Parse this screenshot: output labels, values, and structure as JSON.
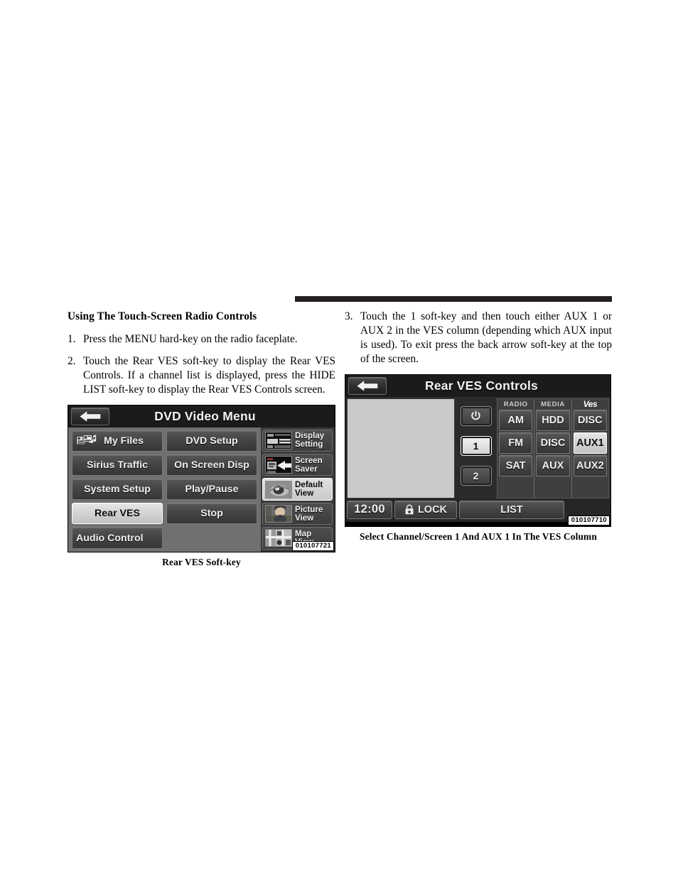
{
  "page": {
    "section_title": "Using The Touch-Screen Radio Controls"
  },
  "steps": [
    {
      "num": "1.",
      "text": "Press the MENU hard-key on the radio faceplate."
    },
    {
      "num": "2.",
      "text": "Touch the Rear VES soft-key to display the Rear VES Controls. If a channel list is displayed, press the HIDE LIST soft-key to display the Rear VES Controls screen."
    },
    {
      "num": "3.",
      "text": "Touch the 1 soft-key and then touch either AUX 1 or AUX 2 in the VES column (depending which AUX input is used). To exit press the back arrow soft-key at the top of the screen."
    }
  ],
  "figure_dvd": {
    "caption": "Rear VES Soft-key",
    "id_tag": "010107721",
    "back_icon": "back-arrow-icon",
    "title": "DVD Video Menu",
    "buttons": [
      {
        "label": "My Files",
        "selected": false,
        "icon": "my-files-icon",
        "align": "left"
      },
      {
        "label": "DVD Setup",
        "selected": false
      },
      {
        "label": "Sirius Traffic",
        "selected": false
      },
      {
        "label": "On Screen Disp",
        "selected": false
      },
      {
        "label": "System Setup",
        "selected": false
      },
      {
        "label": "Play/Pause",
        "selected": false
      },
      {
        "label": "Rear  VES",
        "selected": true
      },
      {
        "label": "Stop",
        "selected": false
      },
      {
        "label": "Audio Control",
        "selected": false,
        "align": "left"
      }
    ],
    "side_keys": [
      {
        "line1": "Display",
        "line2": "Setting",
        "selected": false,
        "icon": "display-setting-thumb"
      },
      {
        "line1": "Screen",
        "line2": "Saver",
        "selected": false,
        "icon": "screen-saver-thumb"
      },
      {
        "line1": "Default",
        "line2": "View",
        "selected": true,
        "icon": "default-view-thumb"
      },
      {
        "line1": "Picture",
        "line2": "View",
        "selected": false,
        "icon": "picture-view-thumb"
      },
      {
        "line1": "Map",
        "line2": "View",
        "selected": false,
        "icon": "map-view-thumb"
      }
    ]
  },
  "figure_ves": {
    "caption": "Select Channel/Screen 1 And AUX 1 In The VES Column",
    "id_tag": "010107710",
    "back_icon": "back-arrow-icon",
    "title": "Rear VES Controls",
    "power_column": [
      {
        "label": "",
        "icon": "power-icon",
        "selected": false
      },
      {
        "label": "1",
        "selected": true
      },
      {
        "label": "2",
        "selected": false
      }
    ],
    "columns": [
      {
        "header": "RADIO",
        "header_style": "text",
        "buttons": [
          {
            "label": "AM",
            "selected": false
          },
          {
            "label": "FM",
            "selected": false
          },
          {
            "label": "SAT",
            "selected": false
          }
        ]
      },
      {
        "header": "MEDIA",
        "header_style": "text",
        "buttons": [
          {
            "label": "HDD",
            "selected": false
          },
          {
            "label": "DISC",
            "selected": false
          },
          {
            "label": "AUX",
            "selected": false
          }
        ]
      },
      {
        "header": "Ves",
        "header_style": "logo",
        "buttons": [
          {
            "label": "DISC",
            "selected": false
          },
          {
            "label": "AUX1",
            "selected": true
          },
          {
            "label": "AUX2",
            "selected": false
          }
        ]
      }
    ],
    "bottom_bar": {
      "clock": "12:00",
      "lock_label": "LOCK",
      "lock_icon": "lock-icon",
      "list_label": "LIST"
    }
  },
  "colors": {
    "rule": "#231f20",
    "screen_bg": "#000000",
    "panel": "#707070",
    "key_face": "#464646",
    "key_selected": "#d2d2d2",
    "video_area": "#c9c9c9"
  }
}
